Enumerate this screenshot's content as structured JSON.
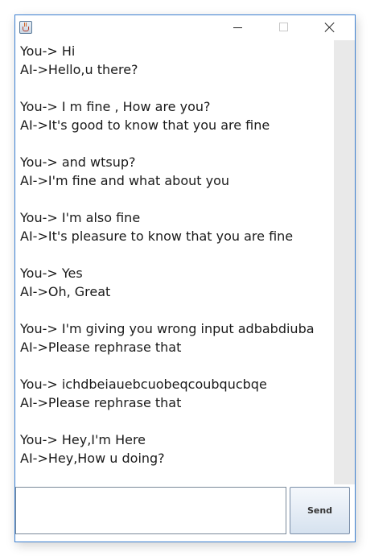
{
  "window": {
    "icon": "java-cup-icon",
    "controls": [
      "minimize-icon",
      "maximize-icon",
      "close-icon"
    ]
  },
  "chat": {
    "lines": [
      "You-> Hi",
      "AI->Hello,u there?",
      "",
      "You-> I m fine , How are you?",
      "AI->It's good to know that you are fine",
      "",
      "You-> and wtsup?",
      "AI->I'm fine and what about you",
      "",
      "You-> I'm also fine",
      "AI->It's pleasure to know that you are fine",
      "",
      "You-> Yes",
      "AI->Oh, Great",
      "",
      "You-> I'm giving you wrong input adbabdiuba",
      "AI->Please rephrase that",
      "",
      "You-> ichdbeiauebcuobeqcoubqucbqe",
      "AI->Please rephrase that",
      "",
      "You-> Hey,I'm Here",
      "AI->Hey,How u doing?"
    ]
  },
  "input": {
    "value": "",
    "placeholder": ""
  },
  "send_button": {
    "label": "Send"
  }
}
